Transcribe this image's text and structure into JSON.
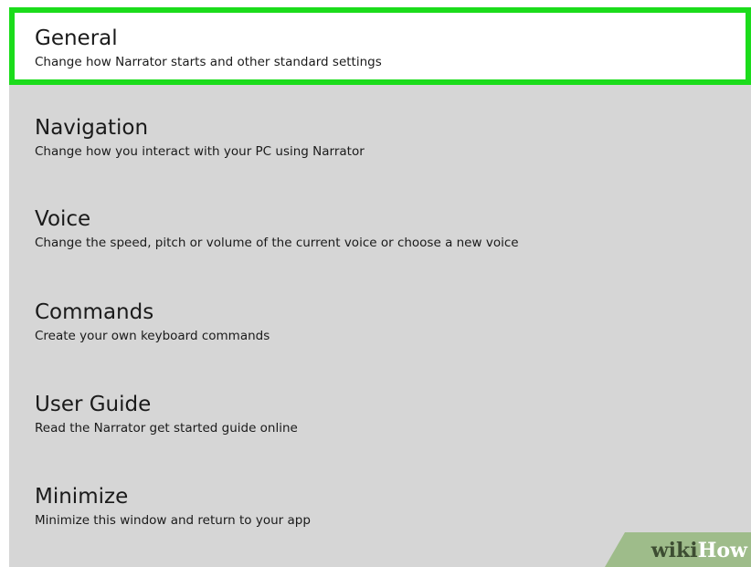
{
  "items": [
    {
      "title": "General",
      "desc": "Change how Narrator starts and other standard settings",
      "selected": true
    },
    {
      "title": "Navigation",
      "desc": "Change how you interact with your PC using Narrator"
    },
    {
      "title": "Voice",
      "desc": "Change the speed, pitch or volume of the current voice or choose a new voice"
    },
    {
      "title": "Commands",
      "desc": "Create your own keyboard commands"
    },
    {
      "title": "User Guide",
      "desc": "Read the Narrator get started guide online"
    },
    {
      "title": "Minimize",
      "desc": "Minimize this window and return to your app"
    }
  ],
  "watermark": {
    "part1": "wiki",
    "part2": "How"
  },
  "colors": {
    "highlight_border": "#1bdc1b",
    "panel_bg": "#d6d6d6",
    "selected_bg": "#ffffff",
    "text": "#1a1a1a"
  }
}
